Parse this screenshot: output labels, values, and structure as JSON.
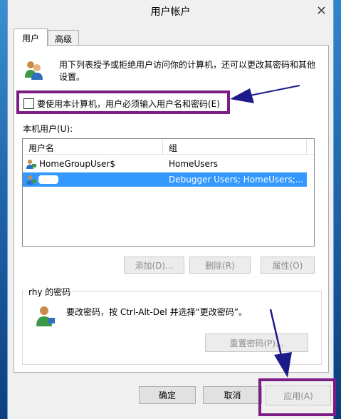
{
  "window": {
    "title": "用户帐户"
  },
  "tabs": [
    {
      "label": "用户"
    },
    {
      "label": "高级"
    }
  ],
  "intro_text_line1": "用下列表授予或拒绝用户访问你的计算机，还可以更改其密码和其他",
  "intro_text_line2": "设置。",
  "require_login_checkbox": {
    "label": "要使用本计算机，用户必须输入用户名和密码(E)",
    "checked": false
  },
  "local_users_label": "本机用户(U):",
  "users_table": {
    "columns": [
      "用户名",
      "组"
    ],
    "rows": [
      {
        "name": "HomeGroupUser$",
        "group": "HomeUsers",
        "selected": false
      },
      {
        "name": "",
        "group": "Debugger Users; HomeUsers;...",
        "selected": true
      }
    ]
  },
  "user_buttons": {
    "add": "添加(D)...",
    "remove": "删除(R)",
    "properties": "属性(O)"
  },
  "password_group": {
    "title": "rhy 的密码",
    "instruction": "要改密码，按 Ctrl-Alt-Del 并选择“更改密码”。",
    "reset_button": "重置密码(P)..."
  },
  "dialog_buttons": {
    "ok": "确定",
    "cancel": "取消",
    "apply": "应用(A)"
  },
  "colors": {
    "annotation_purple": "#7c1d86",
    "arrow": "#1d1a8a",
    "selection": "#3399ff"
  }
}
